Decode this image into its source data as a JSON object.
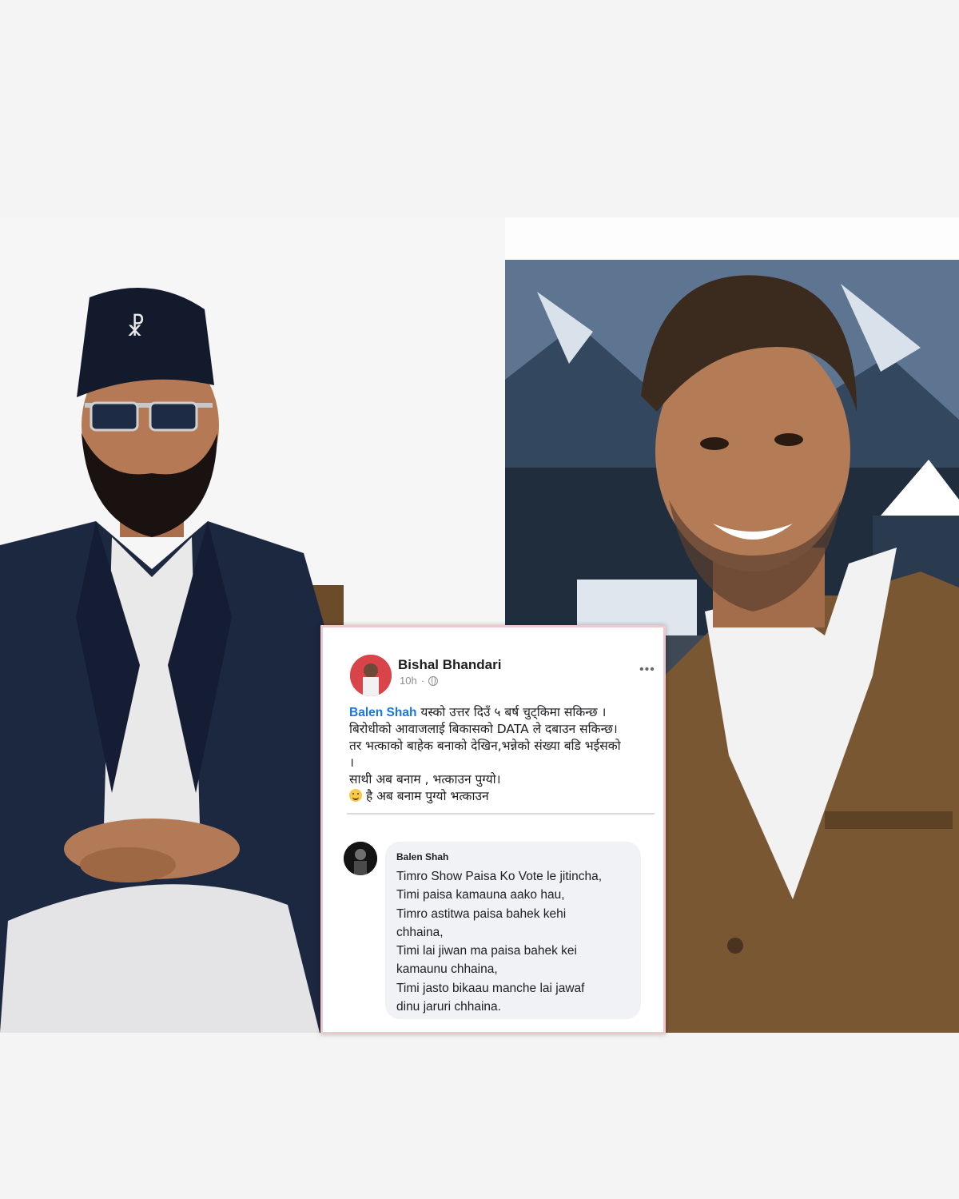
{
  "post": {
    "author": "Bishal Bhandari",
    "time": "10h",
    "more_icon": "more-horizontal-icon",
    "privacy_icon": "globe-icon",
    "mention": "Balen Shah",
    "lines": [
      "यस्को उत्तर दिउँ ५ बर्ष चुट्किमा सकिन्छ ।",
      "बिरोधीको आवाजलाई बिकासको DATA ले दबाउन सकिन्छ।",
      "तर भत्काको बाहेक बनाको देखिन,भन्नेको संख्या बडि भईसको",
      "।",
      "साथी अब बनाम , भत्काउन पुग्यो।",
      "है अब बनाम पुग्यो भत्काउन"
    ],
    "emoji_icon": "smiling-face-icon"
  },
  "comment": {
    "author": "Balen Shah",
    "lines": [
      "Timro Show Paisa Ko Vote le jitincha,",
      "Timi paisa kamauna aako hau,",
      "Timro astitwa paisa bahek kehi",
      "chhaina,",
      "Timi lai jiwan ma paisa bahek kei",
      "kamaunu chhaina,",
      "Timi jasto bikaau manche lai jawaf",
      "dinu jaruri chhaina."
    ]
  },
  "colors": {
    "mention": "#1b74e4",
    "card_border": "#f0c8cc",
    "bubble": "#f0f2f5"
  }
}
